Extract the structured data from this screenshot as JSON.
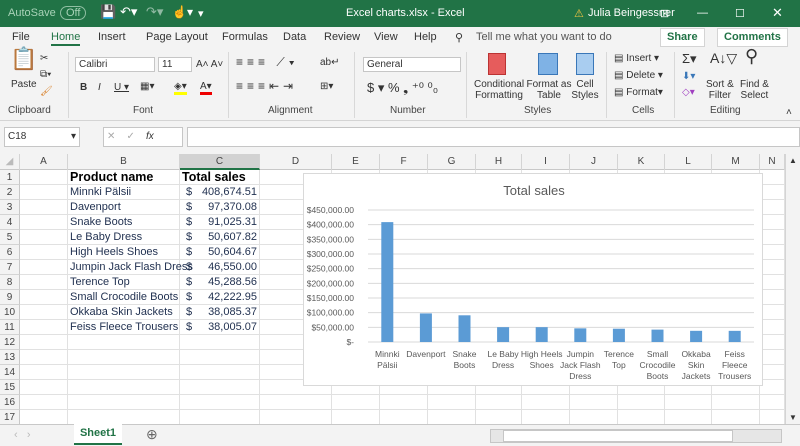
{
  "titlebar": {
    "autosave": "AutoSave",
    "autosave_state": "Off",
    "title": "Excel charts.xlsx  -  Excel",
    "user": "Julia Beingessner"
  },
  "tabs": [
    "File",
    "Home",
    "Insert",
    "Page Layout",
    "Formulas",
    "Data",
    "Review",
    "View",
    "Help"
  ],
  "tell_me": "Tell me what you want to do",
  "share": "Share",
  "comments": "Comments",
  "ribbon": {
    "clipboard": {
      "label": "Clipboard",
      "paste": "Paste"
    },
    "font": {
      "label": "Font",
      "name": "Calibri",
      "size": "11"
    },
    "alignment": {
      "label": "Alignment"
    },
    "number": {
      "label": "Number",
      "format": "General"
    },
    "styles": {
      "label": "Styles",
      "conditional": [
        "Conditional",
        "Formatting"
      ],
      "format_table": [
        "Format as",
        "Table"
      ],
      "cell_styles": [
        "Cell",
        "Styles"
      ]
    },
    "cells": {
      "label": "Cells",
      "insert": "Insert",
      "delete": "Delete",
      "format": "Format"
    },
    "editing": {
      "label": "Editing",
      "sort": [
        "Sort &",
        "Filter"
      ],
      "find": [
        "Find &",
        "Select"
      ]
    }
  },
  "formula_bar": {
    "name_box": "C18",
    "fx": "fx",
    "value": ""
  },
  "columns": [
    "A",
    "B",
    "C",
    "D",
    "E",
    "F",
    "G",
    "H",
    "I",
    "J",
    "K",
    "L",
    "M",
    "N"
  ],
  "selected_column": "C",
  "rows": [
    "1",
    "2",
    "3",
    "4",
    "5",
    "6",
    "7",
    "8",
    "9",
    "10",
    "11",
    "12",
    "13",
    "14",
    "15",
    "16",
    "17"
  ],
  "table": {
    "headers": [
      "Product name",
      "Total sales"
    ],
    "currency": "$",
    "items": [
      {
        "name": "Minnki Pälsii",
        "sales": "408,674.51"
      },
      {
        "name": "Davenport",
        "sales": "97,370.08"
      },
      {
        "name": "Snake Boots",
        "sales": "91,025.31"
      },
      {
        "name": "Le Baby Dress",
        "sales": "50,607.82"
      },
      {
        "name": "High Heels Shoes",
        "sales": "50,604.67"
      },
      {
        "name": "Jumpin Jack Flash Dress",
        "sales": "46,550.00"
      },
      {
        "name": "Terence Top",
        "sales": "45,288.56"
      },
      {
        "name": "Small Crocodile Boots",
        "sales": "42,222.95"
      },
      {
        "name": "Okkaba Skin Jackets",
        "sales": "38,085.37"
      },
      {
        "name": "Feiss Fleece Trousers",
        "sales": "38,005.07"
      }
    ]
  },
  "chart_data": {
    "type": "bar",
    "title": "Total sales",
    "categories": [
      "Minnki Pälsii",
      "Davenport",
      "Snake Boots",
      "Le Baby Dress",
      "High Heels Shoes",
      "Jumpin Jack Flash Dress",
      "Terence Top",
      "Small Crocodile Boots",
      "Okkaba Skin Jackets",
      "Feiss Fleece Trousers"
    ],
    "category_labels": [
      [
        "Minnki",
        "Pälsii"
      ],
      [
        "Davenport"
      ],
      [
        "Snake",
        "Boots"
      ],
      [
        "Le Baby",
        "Dress"
      ],
      [
        "High Heels",
        "Shoes"
      ],
      [
        "Jumpin",
        "Jack Flash",
        "Dress"
      ],
      [
        "Terence",
        "Top"
      ],
      [
        "Small",
        "Crocodile",
        "Boots"
      ],
      [
        "Okkaba",
        "Skin",
        "Jackets"
      ],
      [
        "Feiss",
        "Fleece",
        "Trousers"
      ]
    ],
    "values": [
      408674.51,
      97370.08,
      91025.31,
      50607.82,
      50604.67,
      46550.0,
      45288.56,
      42222.95,
      38085.37,
      38005.07
    ],
    "ylim": [
      0,
      450000
    ],
    "yticks": [
      "$-",
      "$50,000.00",
      "$100,000.00",
      "$150,000.00",
      "$200,000.00",
      "$250,000.00",
      "$300,000.00",
      "$350,000.00",
      "$400,000.00",
      "$450,000.00"
    ],
    "grid": true,
    "legend": "none",
    "bar_color": "#5b9bd5"
  },
  "sheets": [
    "Sheet1"
  ],
  "colors": {
    "accent": "#217346"
  }
}
